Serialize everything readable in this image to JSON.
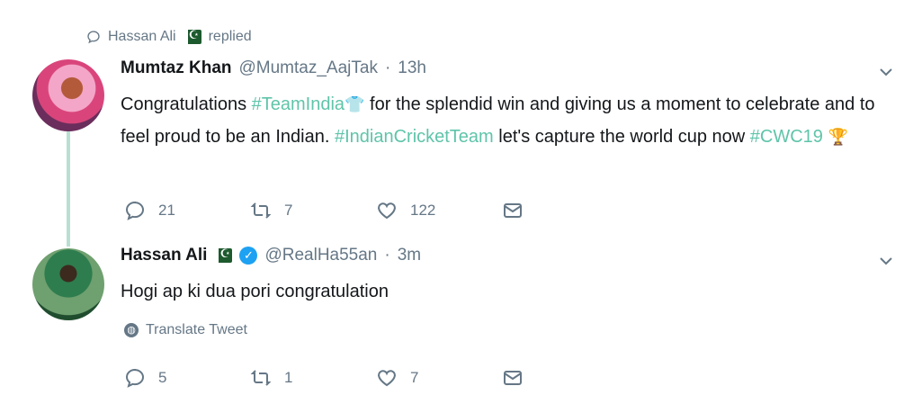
{
  "context": {
    "name": "Hassan Ali",
    "label": "replied"
  },
  "tweets": [
    {
      "name": "Mumtaz Khan",
      "handle": "@Mumtaz_AajTak",
      "dot": "·",
      "time": "13h",
      "body": {
        "t1": "Congratulations ",
        "h1": "#TeamIndia",
        "t2": " for the splendid win and giving us a moment to celebrate and to feel proud to be an Indian. ",
        "h2": "#IndianCricketTeam",
        "t3": " let's capture the world cup now ",
        "h3": "#CWC19"
      },
      "counts": {
        "reply": "21",
        "retweet": "7",
        "like": "122"
      }
    },
    {
      "name": "Hassan Ali",
      "handle": "@RealHa55an",
      "dot": "·",
      "time": "3m",
      "body": {
        "t1": "Hogi ap ki dua pori congratulation"
      },
      "translate": "Translate Tweet",
      "counts": {
        "reply": "5",
        "retweet": "1",
        "like": "7"
      }
    }
  ],
  "icons": {
    "reply": "reply-icon",
    "retweet": "retweet-icon",
    "like": "like-icon",
    "dm": "message-icon",
    "chevron": "chevron-down-icon"
  },
  "colors": {
    "hashtag": "#5fc4a9",
    "muted": "#657786",
    "thread": "#b8e0d2",
    "verified": "#1da1f2"
  }
}
